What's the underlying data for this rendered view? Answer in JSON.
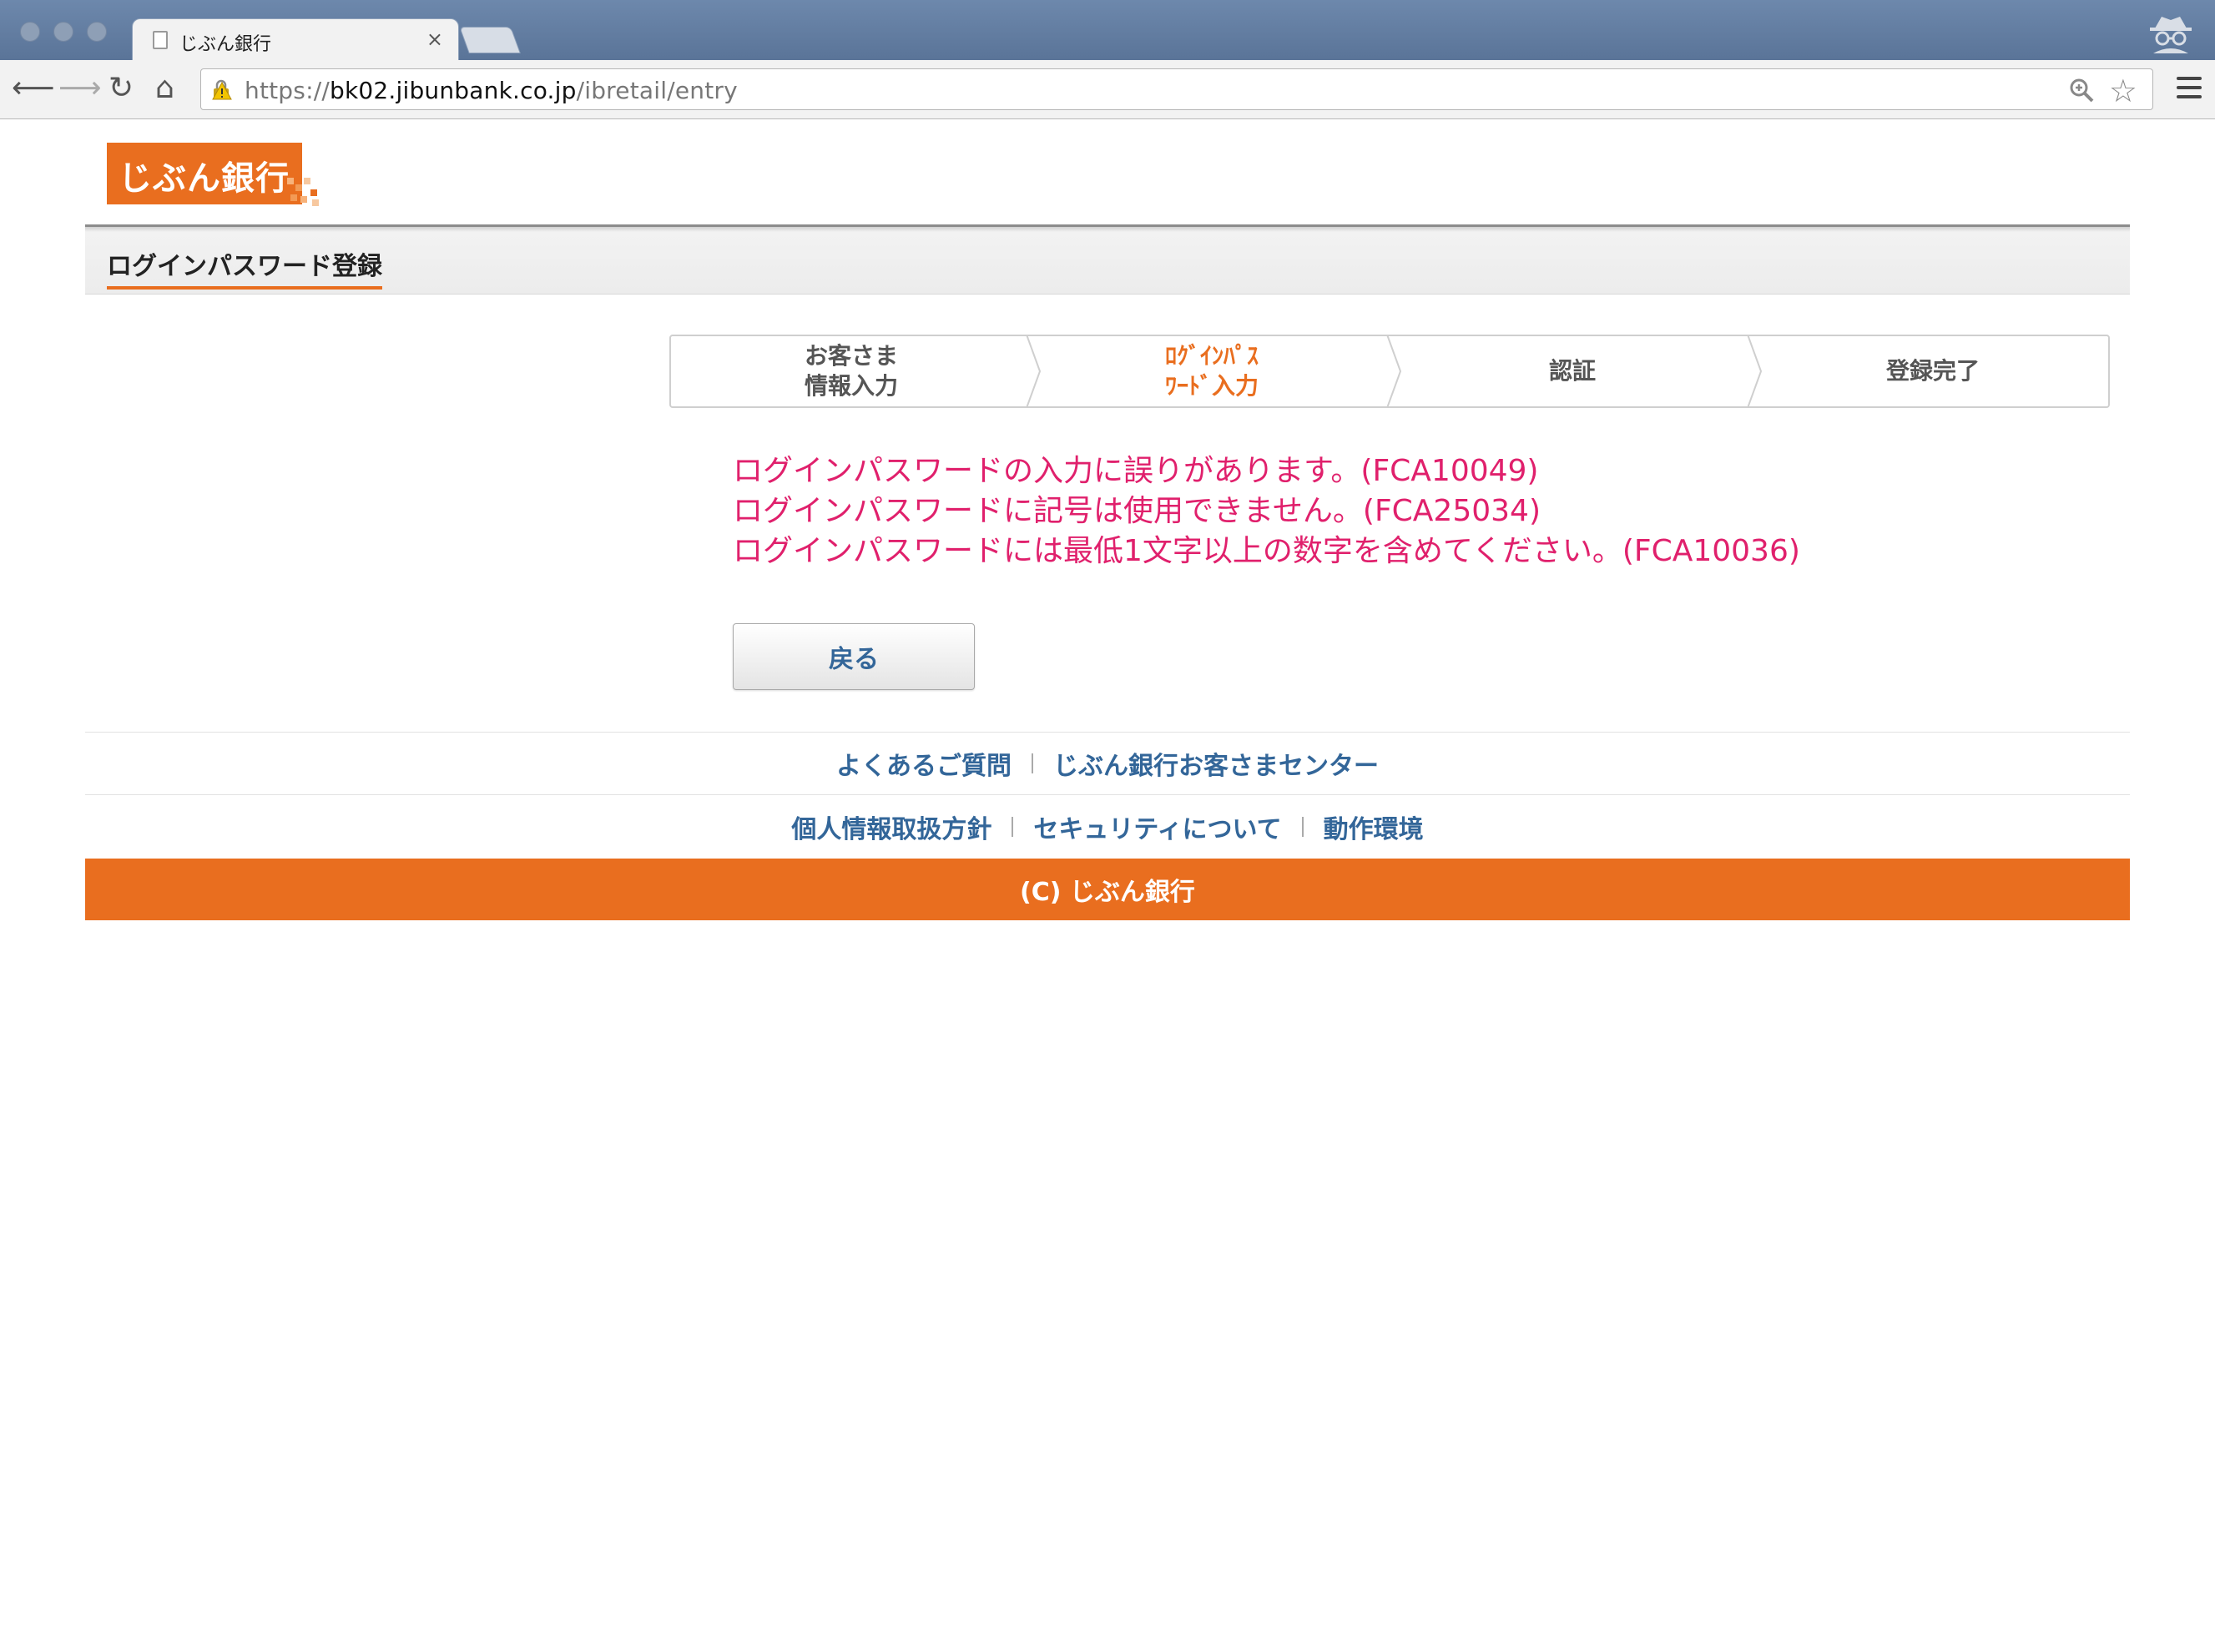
{
  "browser": {
    "tab_title": "じぶん銀行",
    "tab_close": "×",
    "url_scheme": "https://",
    "url_host": "bk02.jibunbank.co.jp",
    "url_path": "/ibretail/entry"
  },
  "logo": {
    "text": "じぶん銀行"
  },
  "header": {
    "title": "ログインパスワード登録"
  },
  "steps": [
    {
      "line1": "お客さま",
      "line2": "情報入力",
      "active": false
    },
    {
      "line1": "ﾛｸﾞｲﾝﾊﾟｽ",
      "line2": "ﾜｰﾄﾞ入力",
      "active": true
    },
    {
      "line1": "認証",
      "line2": "",
      "active": false
    },
    {
      "line1": "登録完了",
      "line2": "",
      "active": false
    }
  ],
  "errors": [
    "ログインパスワードの入力に誤りがあります。(FCA10049)",
    "ログインパスワードに記号は使用できません。(FCA25034)",
    "ログインパスワードには最低1文字以上の数字を含めてください。(FCA10036)"
  ],
  "back_button": {
    "label": "戻る"
  },
  "footer": {
    "row1": [
      "よくあるご質問",
      "じぶん銀行お客さまセンター"
    ],
    "row2": [
      "個人情報取扱方針",
      "セキュリティについて",
      "動作環境"
    ],
    "copyright": "(C) じぶん銀行"
  },
  "colors": {
    "brand": "#e96e1f",
    "error": "#e0206c",
    "link": "#336699"
  }
}
